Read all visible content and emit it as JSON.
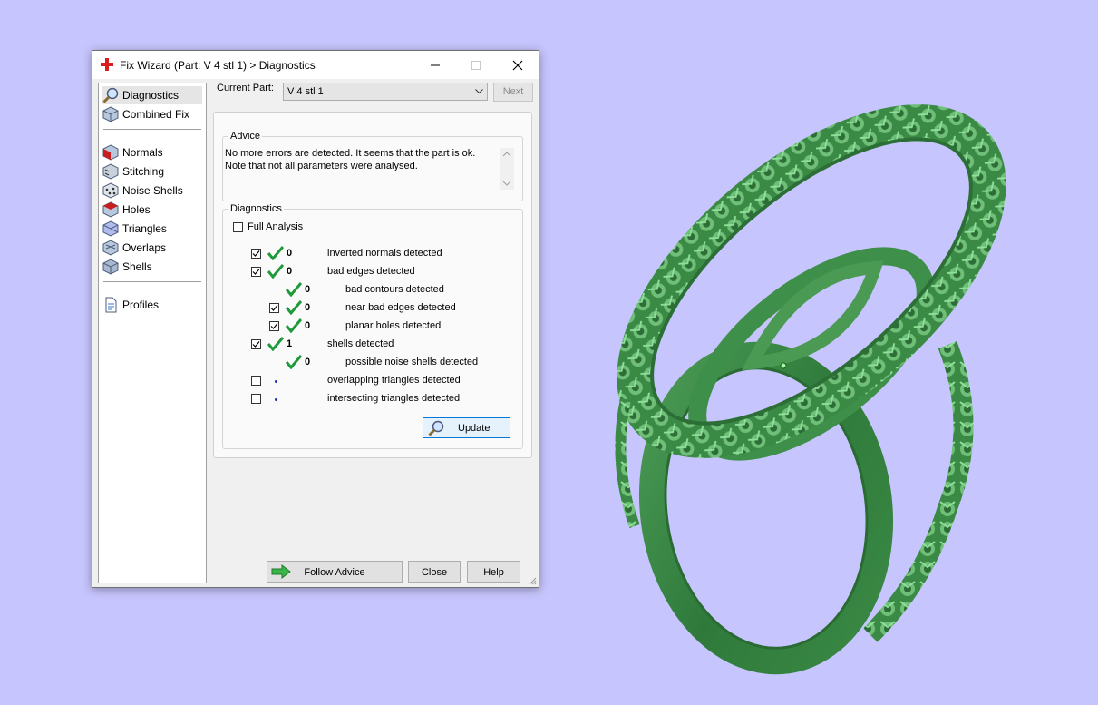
{
  "window": {
    "title": "Fix Wizard (Part: V 4 stl 1) > Diagnostics"
  },
  "nav": {
    "items": [
      {
        "label": "Diagnostics",
        "icon": "magnifier-icon",
        "active": true
      },
      {
        "label": "Combined Fix",
        "icon": "cube-icon",
        "active": false
      },
      {
        "label": "Normals",
        "icon": "normals-cube-icon",
        "active": false
      },
      {
        "label": "Stitching",
        "icon": "stitching-cube-icon",
        "active": false
      },
      {
        "label": "Noise Shells",
        "icon": "noise-shells-icon",
        "active": false
      },
      {
        "label": "Holes",
        "icon": "holes-cube-icon",
        "active": false
      },
      {
        "label": "Triangles",
        "icon": "triangles-cube-icon",
        "active": false
      },
      {
        "label": "Overlaps",
        "icon": "overlaps-cube-icon",
        "active": false
      },
      {
        "label": "Shells",
        "icon": "shells-cube-icon",
        "active": false
      },
      {
        "label": "Profiles",
        "icon": "document-icon",
        "active": false
      }
    ]
  },
  "current_part": {
    "label": "Current Part:",
    "value": "V 4 stl 1",
    "next_label": "Next"
  },
  "advice": {
    "title": "Advice",
    "line1": "No more errors are detected. It seems that the part is ok.",
    "line2": "Note that not all parameters were analysed."
  },
  "diagnostics": {
    "title": "Diagnostics",
    "full_analysis_label": "Full Analysis",
    "full_analysis_checked": false,
    "rows": [
      {
        "label": "inverted normals detected",
        "count": "0",
        "checked": true,
        "status": "ok"
      },
      {
        "label": "bad edges detected",
        "count": "0",
        "checked": true,
        "status": "ok"
      },
      {
        "label": "bad contours detected",
        "count": "0",
        "checked": null,
        "status": "ok"
      },
      {
        "label": "near bad edges detected",
        "count": "0",
        "checked": true,
        "status": "ok"
      },
      {
        "label": "planar holes detected",
        "count": "0",
        "checked": true,
        "status": "ok"
      },
      {
        "label": "shells detected",
        "count": "1",
        "checked": true,
        "status": "ok"
      },
      {
        "label": "possible noise shells detected",
        "count": "0",
        "checked": null,
        "status": "ok"
      },
      {
        "label": "overlapping triangles detected",
        "count": "",
        "checked": false,
        "status": "not-analysed"
      },
      {
        "label": "intersecting triangles detected",
        "count": "",
        "checked": false,
        "status": "not-analysed"
      }
    ],
    "update_label": "Update"
  },
  "buttons": {
    "follow_advice": "Follow Advice",
    "close": "Close",
    "help": "Help"
  },
  "colors": {
    "background": "#c7c5fd",
    "ring_green": "#3f8e4a",
    "check_green": "#1e9a3a"
  }
}
